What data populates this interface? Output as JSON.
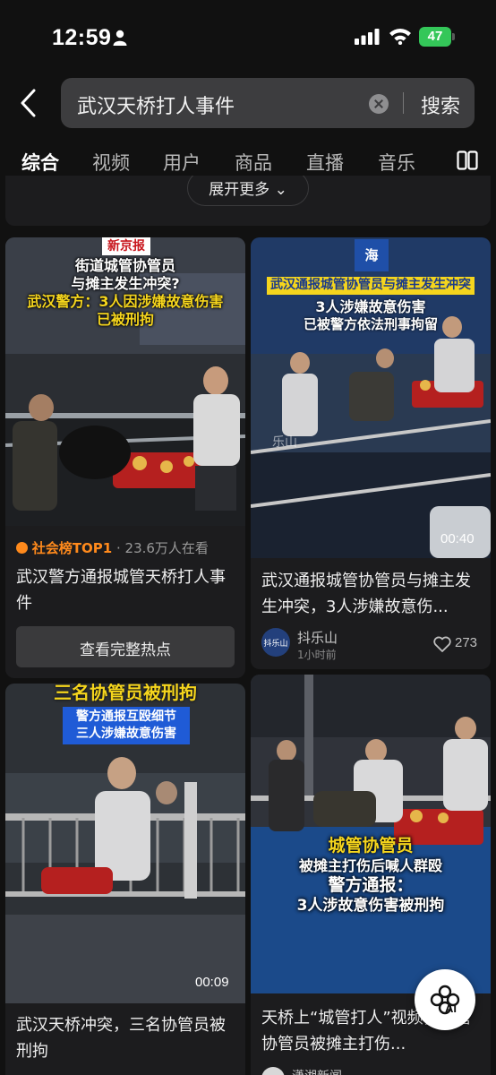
{
  "status_bar": {
    "time": "12:59",
    "battery": "47"
  },
  "search": {
    "query": "武汉天桥打人事件",
    "submit_label": "搜索"
  },
  "tabs": [
    {
      "label": "综合",
      "active": true
    },
    {
      "label": "视频"
    },
    {
      "label": "用户"
    },
    {
      "label": "商品"
    },
    {
      "label": "直播"
    },
    {
      "label": "音乐"
    }
  ],
  "expand_label": "展开更多",
  "cards": [
    {
      "source_mark": "新京报",
      "caption_lines": [
        "街道城管协管员",
        "与摊主发生冲突?",
        "武汉警方：3人因涉嫌故意伤害",
        "已被刑拘"
      ],
      "badge": "社会榜TOP1",
      "views": "· 23.6万人在看",
      "title": "武汉警方通报城管天桥打人事件",
      "button": "查看完整热点"
    },
    {
      "logo_text": "海",
      "caption_lines": [
        "武汉通报城管协管员与摊主发生冲突",
        "3人涉嫌故意伤害",
        "已被警方依法刑事拘留"
      ],
      "watermark": "乐山",
      "duration": "00:40",
      "title": "武汉通报城管协管员与摊主发生冲突，3人涉嫌故意伤...",
      "author": "抖乐山",
      "avatar_text": "抖乐山",
      "time_ago": "1小时前",
      "likes": "273"
    },
    {
      "caption_lines": [
        "三名协管员被刑拘",
        "警方通报互殴细节",
        "三人涉嫌故意伤害"
      ],
      "duration": "00:09",
      "title": "武汉天桥冲突，三名协管员被刑拘"
    },
    {
      "caption_lines": [
        "城管协管员",
        "被摊主打伤后喊人群殴",
        "警方通报：",
        "3人涉故意伤害被刑拘"
      ],
      "title": "天桥上“城管打人”视频，城管协管员被摊主打伤...",
      "author": "潇湘新闻"
    }
  ],
  "ai_label": "AI",
  "colors": {
    "background": "#111111",
    "card": "#1c1c1e",
    "search_box": "#3d3d3f",
    "caption_yellow": "#f5d51d",
    "badge_orange": "#ff8a1c",
    "battery_green": "#34c759"
  }
}
